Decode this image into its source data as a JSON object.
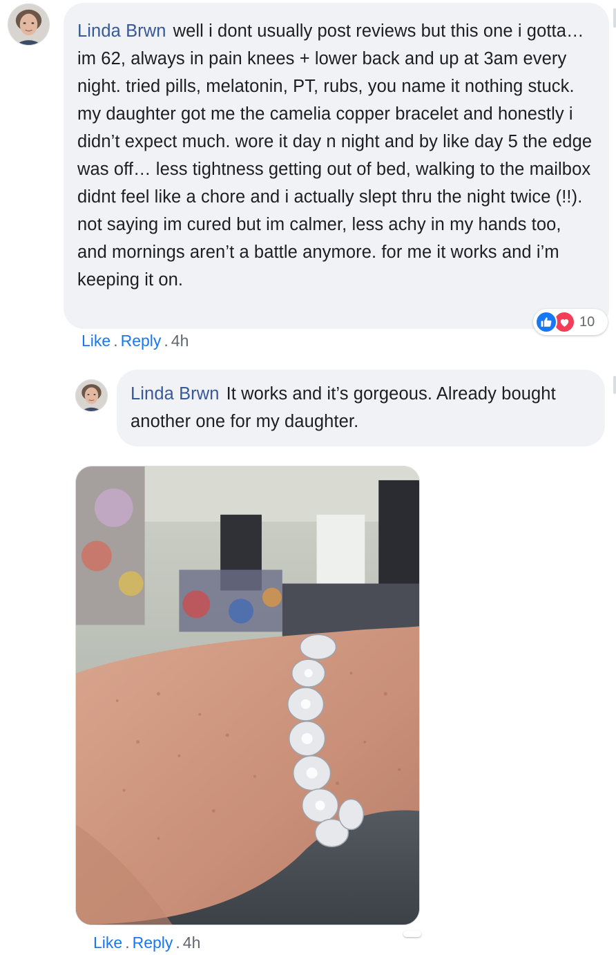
{
  "comment": {
    "author": "Linda Brwn",
    "text": "well i dont usually post reviews but this one i gotta… im 62, always in pain knees + lower back and up at 3am every night. tried pills, melatonin, PT, rubs, you name it nothing stuck. my daughter got me the camelia copper bracelet and honestly i didn’t expect much. wore it day n night and by like day 5 the edge was off… less tightness getting out of bed, walking to the mailbox didnt feel like a chore and i actually slept thru the night twice (!!). not saying im cured but im calmer, less achy in my hands too, and mornings aren’t a battle anymore. for me it works and i’m keeping it on.",
    "reactions": {
      "icons": [
        "like-icon",
        "love-icon"
      ],
      "count": "10"
    },
    "actions": {
      "like": "Like",
      "reply": "Reply",
      "time": "4h",
      "separator": "."
    }
  },
  "reply": {
    "author": "Linda Brwn",
    "text": "It works and it’s gorgeous. Already bought another one for my daughter.",
    "photo": "bracelet-on-wrist-photo",
    "actions": {
      "like": "Like",
      "reply": "Reply",
      "time": "4h",
      "separator": "."
    }
  },
  "colors": {
    "author": "#385898",
    "link": "#1877f2",
    "bubble": "#f0f2f5",
    "like": "#1877f2",
    "love": "#f33e58"
  }
}
